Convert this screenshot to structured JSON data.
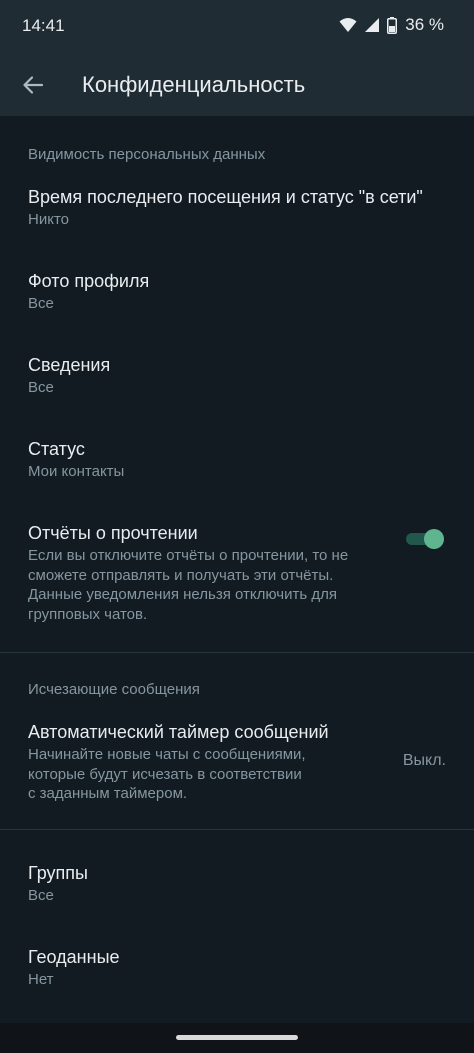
{
  "status_bar": {
    "time": "14:41",
    "battery_percent": "36 %",
    "icons": [
      "wifi-icon",
      "signal-icon",
      "battery-icon"
    ]
  },
  "app_bar": {
    "title": "Конфиденциальность",
    "back_icon": "arrow-left-icon"
  },
  "section_visibility": {
    "header": "Видимость персональных данных",
    "items": [
      {
        "title": "Время последнего посещения и статус \"в сети\"",
        "value": "Никто"
      },
      {
        "title": "Фото профиля",
        "value": "Все"
      },
      {
        "title": "Сведения",
        "value": "Все"
      },
      {
        "title": "Статус",
        "value": "Мои контакты"
      }
    ],
    "read_receipts": {
      "title": "Отчёты о прочтении",
      "description_lines": [
        "Если вы отключите отчёты о прочтении, то не",
        "сможете отправлять и получать эти отчёты.",
        "Данные уведомления нельзя отключить для",
        "групповых чатов."
      ],
      "enabled": true
    }
  },
  "section_disappearing": {
    "header": "Исчезающие сообщения",
    "timer": {
      "title": "Автоматический таймер сообщений",
      "description_lines": [
        "Начинайте новые чаты с сообщениями,",
        "которые будут исчезать в соответствии",
        "с заданным таймером."
      ],
      "value": "Выкл."
    }
  },
  "section_other": {
    "items": [
      {
        "title": "Группы",
        "value": "Все"
      },
      {
        "title": "Геоданные",
        "value": "Нет"
      }
    ]
  },
  "colors": {
    "background": "#121b22",
    "bar": "#1f2c34",
    "accent": "#5fb58f",
    "secondary_text": "#8696a0"
  }
}
